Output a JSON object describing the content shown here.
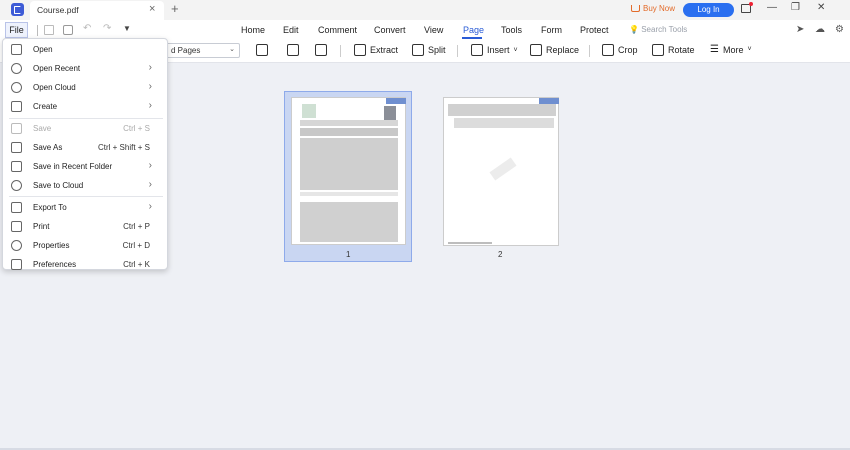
{
  "titlebar": {
    "tab_title": "Course.pdf",
    "tab_close": "×",
    "tab_add": "+",
    "buy_now": "Buy Now",
    "login": "Log In",
    "minimize": "—",
    "restore": "❐",
    "close": "✕"
  },
  "menubar": {
    "file": "File",
    "items": [
      "Home",
      "Edit",
      "Comment",
      "Convert",
      "View",
      "Page",
      "Tools",
      "Form",
      "Protect"
    ],
    "search_placeholder": "Search Tools",
    "undo": "↶",
    "redo": "↷",
    "more_arrow": "▼",
    "active": "Page"
  },
  "toolbar": {
    "page_select_value": "d Pages",
    "select_arrow": "⌄",
    "extract": "Extract",
    "split": "Split",
    "insert": "Insert",
    "replace": "Replace",
    "crop": "Crop",
    "rotate": "Rotate",
    "more": "More",
    "dropdown_chevron": "˅"
  },
  "pages": [
    {
      "number": "1"
    },
    {
      "number": "2"
    }
  ],
  "file_menu": {
    "items": [
      {
        "label": "Open",
        "shortcut": "",
        "submenu": false,
        "disabled": false
      },
      {
        "label": "Open Recent",
        "shortcut": "",
        "submenu": true,
        "disabled": false
      },
      {
        "label": "Open Cloud",
        "shortcut": "",
        "submenu": true,
        "disabled": false
      },
      {
        "label": "Create",
        "shortcut": "",
        "submenu": true,
        "disabled": false
      },
      {
        "label": "Save",
        "shortcut": "Ctrl + S",
        "submenu": false,
        "disabled": true
      },
      {
        "label": "Save As",
        "shortcut": "Ctrl + Shift + S",
        "submenu": false,
        "disabled": false
      },
      {
        "label": "Save in Recent Folder",
        "shortcut": "",
        "submenu": true,
        "disabled": false
      },
      {
        "label": "Save to Cloud",
        "shortcut": "",
        "submenu": true,
        "disabled": false
      },
      {
        "label": "Export To",
        "shortcut": "",
        "submenu": true,
        "disabled": false
      },
      {
        "label": "Print",
        "shortcut": "Ctrl + P",
        "submenu": false,
        "disabled": false
      },
      {
        "label": "Properties",
        "shortcut": "Ctrl + D",
        "submenu": false,
        "disabled": false
      },
      {
        "label": "Preferences",
        "shortcut": "Ctrl + K",
        "submenu": false,
        "disabled": false
      }
    ],
    "submenu_arrow": "›"
  },
  "colors": {
    "accent": "#2a5cd6",
    "login_bg": "#2a6ff0",
    "buy_now": "#e36b2a",
    "selection": "#c9d6f2"
  }
}
